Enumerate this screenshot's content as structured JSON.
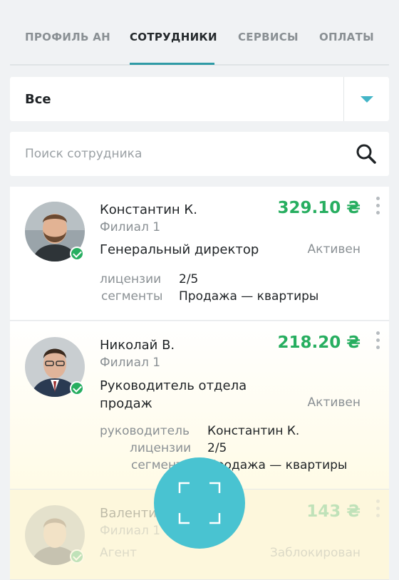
{
  "tabs": [
    {
      "label": "ПРОФИЛЬ АН",
      "active": false
    },
    {
      "label": "СОТРУДНИКИ",
      "active": true
    },
    {
      "label": "СЕРВИСЫ",
      "active": false
    },
    {
      "label": "ОПЛАТЫ",
      "active": false
    }
  ],
  "filter": {
    "value": "Все"
  },
  "search": {
    "placeholder": "Поиск сотрудника",
    "value": ""
  },
  "colors": {
    "accent": "#2f9ba6",
    "fab": "#49c3d1",
    "amount": "#27ae60",
    "badge": "#27ae60"
  },
  "employees": [
    {
      "name": "Константин К.",
      "branch": "Филиал 1",
      "amount": "329.10 ₴",
      "role": "Генеральный директор",
      "status": "Активен",
      "fields": [
        {
          "label": "лицензии",
          "value": "2/5"
        },
        {
          "label": "сегменты",
          "value": "Продажа — квартиры"
        }
      ],
      "verified": true
    },
    {
      "name": "Николай В.",
      "branch": "Филиал 1",
      "amount": "218.20 ₴",
      "role_line1": "Руководитель отдела",
      "role_line2": "продаж",
      "status": "Активен",
      "fields": [
        {
          "label": "руководитель",
          "value": "Константин К."
        },
        {
          "label": "лицензии",
          "value": "2/5"
        },
        {
          "label": "сегменты",
          "value": "Продажа — квартиры"
        }
      ],
      "verified": true
    },
    {
      "name": "Валентин",
      "branch": "Филиал 1",
      "amount": "143 ₴",
      "role": "Агент",
      "status": "Заблокирован",
      "verified": true
    }
  ],
  "icons": {
    "search": "search-icon",
    "more": "kebab-menu-icon",
    "fab": "fullscreen-icon",
    "verified": "check-badge-icon"
  }
}
